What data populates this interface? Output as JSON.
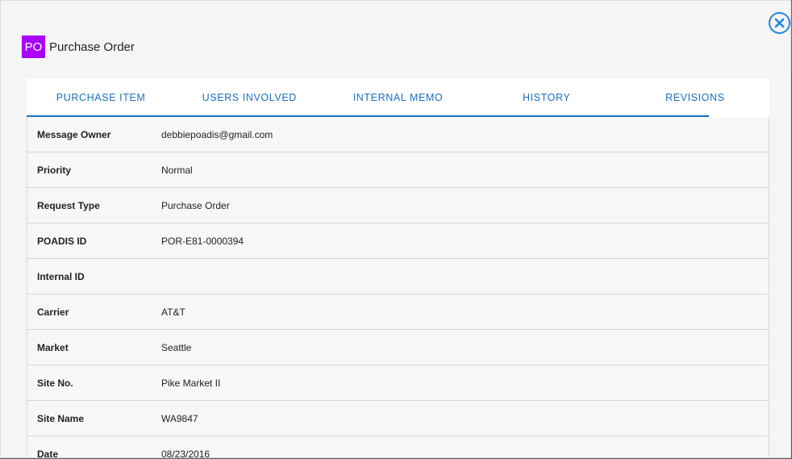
{
  "header": {
    "badge": "PO",
    "title": "Purchase Order"
  },
  "close_icon": "close-circle-icon",
  "colors": {
    "accent": "#1a6fc0",
    "badge": "#aa00ff"
  },
  "tabs": [
    {
      "label": "PURCHASE ITEM"
    },
    {
      "label": "USERS INVOLVED"
    },
    {
      "label": "INTERNAL MEMO"
    },
    {
      "label": "HISTORY"
    },
    {
      "label": "REVISIONS"
    }
  ],
  "details": [
    {
      "label": "Message Owner",
      "value": "debbiepoadis@gmail.com"
    },
    {
      "label": "Priority",
      "value": "Normal"
    },
    {
      "label": "Request Type",
      "value": "Purchase Order"
    },
    {
      "label": "POADIS ID",
      "value": "POR-E81-0000394"
    },
    {
      "label": "Internal ID",
      "value": ""
    },
    {
      "label": "Carrier",
      "value": "AT&T"
    },
    {
      "label": "Market",
      "value": "Seattle"
    },
    {
      "label": "Site No.",
      "value": "Pike Market II"
    },
    {
      "label": "Site Name",
      "value": "WA9847"
    },
    {
      "label": "Date",
      "value": "08/23/2016"
    }
  ]
}
